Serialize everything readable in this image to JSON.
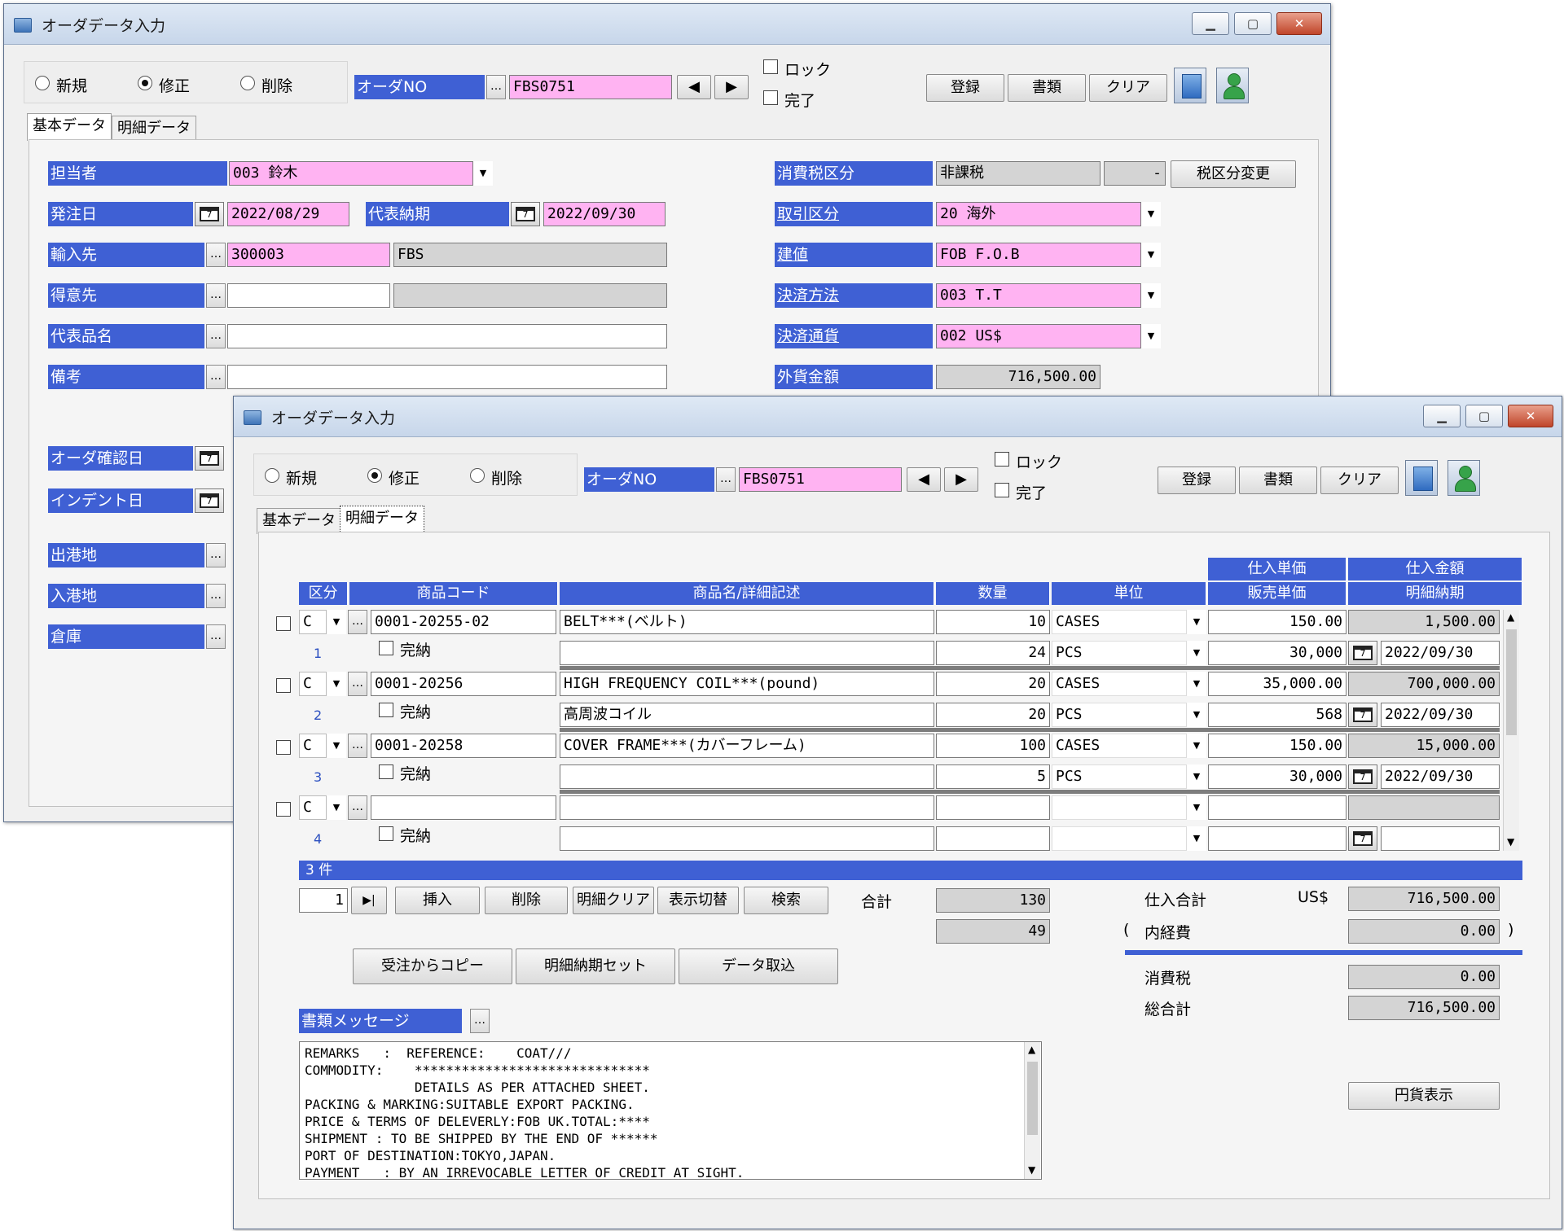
{
  "window_title": "オーダデータ入力",
  "mode": {
    "new": "新規",
    "edit": "修正",
    "delete": "削除"
  },
  "order_no_label": "オーダNO",
  "order_no": "FBS0751",
  "lock": "ロック",
  "complete": "完了",
  "top_buttons": {
    "register": "登録",
    "documents": "書類",
    "clear": "クリア"
  },
  "tabs": {
    "basic": "基本データ",
    "detail": "明細データ"
  },
  "basic": {
    "tanto_label": "担当者",
    "tanto": "003 鈴木",
    "order_date_label": "発注日",
    "order_date": "2022/08/29",
    "delivery_label": "代表納期",
    "delivery": "2022/09/30",
    "supplier_label": "輸入先",
    "supplier_code": "300003",
    "supplier_name": "FBS",
    "customer_label": "得意先",
    "item_label": "代表品名",
    "note_label": "備考",
    "tax_label": "消費税区分",
    "tax": "非課税",
    "tax_small": "-",
    "tax_change": "税区分変更",
    "trade_label": "取引区分",
    "trade": "20 海外",
    "price_term_label": "建値",
    "price_term": "FOB F.O.B",
    "payment_label": "決済方法",
    "payment": "003 T.T",
    "currency_label": "決済通貨",
    "currency": "002 US$",
    "fx_amount_label": "外貨金額",
    "fx_amount": "716,500.00",
    "confirm_label": "オーダ確認日",
    "indent_label": "インデント日",
    "port_from_label": "出港地",
    "port_to_label": "入港地",
    "warehouse_label": "倉庫"
  },
  "detail": {
    "headers": {
      "kubun": "区分",
      "code": "商品コード",
      "name": "商品名/詳細記述",
      "qty": "数量",
      "unit": "単位",
      "buy_price": "仕入単価",
      "sell_price": "販売単価",
      "buy_amount": "仕入金額",
      "delivery": "明細納期"
    },
    "kanno": "完納",
    "rows": [
      {
        "no": "1",
        "kubun": "C",
        "code": "0001-20255-02",
        "name": "BELT***(ベルト)",
        "qty": "10",
        "unit": "CASES",
        "buy_price": "150.00",
        "buy_amount": "1,500.00",
        "sub_name": "",
        "sub_qty": "24",
        "sub_unit": "PCS",
        "sell_price": "30,000",
        "delivery": "2022/09/30"
      },
      {
        "no": "2",
        "kubun": "C",
        "code": "0001-20256",
        "name": "HIGH FREQUENCY COIL***(pound)",
        "qty": "20",
        "unit": "CASES",
        "buy_price": "35,000.00",
        "buy_amount": "700,000.00",
        "sub_name": "高周波コイル",
        "sub_qty": "20",
        "sub_unit": "PCS",
        "sell_price": "568",
        "delivery": "2022/09/30"
      },
      {
        "no": "3",
        "kubun": "C",
        "code": "0001-20258",
        "name": "COVER FRAME***(カバーフレーム)",
        "qty": "100",
        "unit": "CASES",
        "buy_price": "150.00",
        "buy_amount": "15,000.00",
        "sub_name": "",
        "sub_qty": "5",
        "sub_unit": "PCS",
        "sell_price": "30,000",
        "delivery": "2022/09/30"
      },
      {
        "no": "4",
        "kubun": "C",
        "code": "",
        "name": "",
        "qty": "",
        "unit": "",
        "buy_price": "",
        "buy_amount": "",
        "sub_name": "",
        "sub_qty": "",
        "sub_unit": "",
        "sell_price": "",
        "delivery": ""
      }
    ],
    "count": "3 件",
    "page": "1",
    "page_last": "▶|",
    "buttons": {
      "insert": "挿入",
      "delete": "削除",
      "clear": "明細クリア",
      "toggle": "表示切替",
      "search": "検索"
    },
    "total_label": "合計",
    "total_qty": "130",
    "total_sub_qty": "49",
    "buy_total_label": "仕入合計",
    "currency_sym": "US$",
    "buy_total": "716,500.00",
    "paren_open": "(",
    "paren_close": ")",
    "expense_label": "内経費",
    "expense": "0.00",
    "tax_label": "消費税",
    "tax": "0.00",
    "grand_label": "総合計",
    "grand": "716,500.00",
    "bottom_buttons": {
      "copy": "受注からコピー",
      "set_delivery": "明細納期セット",
      "import": "データ取込"
    },
    "yen_button": "円貨表示",
    "message_label": "書類メッセージ",
    "message": "REMARKS   :  REFERENCE:    COAT///\nCOMMODITY:    ******************************\n              DETAILS AS PER ATTACHED SHEET.\nPACKING & MARKING:SUITABLE EXPORT PACKING.\nPRICE & TERMS OF DELEVERLY:FOB UK.TOTAL:****\nSHIPMENT : TO BE SHIPPED BY THE END OF ******\nPORT OF DESTINATION:TOKYO,JAPAN.\nPAYMENT   : BY AN IRREVOCABLE LETTER OF CREDIT AT SIGHT."
  },
  "icons": [
    "app-icon",
    "minimize-icon",
    "maximize-icon",
    "close-icon",
    "calendar-icon",
    "doc-stack-icon",
    "user-icon",
    "triangle-left-icon",
    "triangle-right-icon",
    "dropdown-arrow-icon"
  ],
  "colors": {
    "label_blue": "#3f60d4",
    "required_pink": "#ffb3f2",
    "readonly_gray": "#d4d4d4"
  }
}
